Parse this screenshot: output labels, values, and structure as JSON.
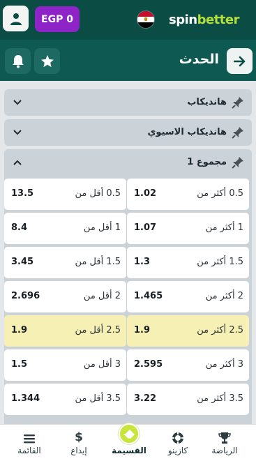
{
  "header": {
    "balance": "EGP 0",
    "logo_spin": "spin",
    "logo_better": "better",
    "flag": "egypt-flag",
    "accent": "#8e23c8",
    "bar_color": "#0b4c45"
  },
  "subheader": {
    "title": "الحدث"
  },
  "groups": [
    {
      "title": "هانديكاب",
      "expanded": false
    },
    {
      "title": "هانديكاب الاسيوي",
      "expanded": false
    },
    {
      "title": "مجموع 1",
      "expanded": true
    }
  ],
  "odds": [
    {
      "right_label": "0.5 أكثر من",
      "right_odd": "1.02",
      "left_label": "0.5 أقل من",
      "left_odd": "13.5",
      "highlight": false
    },
    {
      "right_label": "1 أكثر من",
      "right_odd": "1.07",
      "left_label": "1 أقل من",
      "left_odd": "8.4",
      "highlight": false
    },
    {
      "right_label": "1.5 أكثر من",
      "right_odd": "1.3",
      "left_label": "1.5 أقل من",
      "left_odd": "3.45",
      "highlight": false
    },
    {
      "right_label": "2 أكثر من",
      "right_odd": "1.465",
      "left_label": "2 أقل من",
      "left_odd": "2.696",
      "highlight": false
    },
    {
      "right_label": "2.5 أكثر من",
      "right_odd": "1.9",
      "left_label": "2.5 أقل من",
      "left_odd": "1.9",
      "highlight": true
    },
    {
      "right_label": "3 أكثر من",
      "right_odd": "2.595",
      "left_label": "3 أقل من",
      "left_odd": "1.5",
      "highlight": false
    },
    {
      "right_label": "3.5 أكثر من",
      "right_odd": "3.22",
      "left_label": "3.5 أقل من",
      "left_odd": "1.344",
      "highlight": false
    }
  ],
  "nav": {
    "sports": "الرياضة",
    "casino": "كازينو",
    "coupon": "القسيمة",
    "deposit": "إيداع",
    "menu": "القائمة"
  }
}
